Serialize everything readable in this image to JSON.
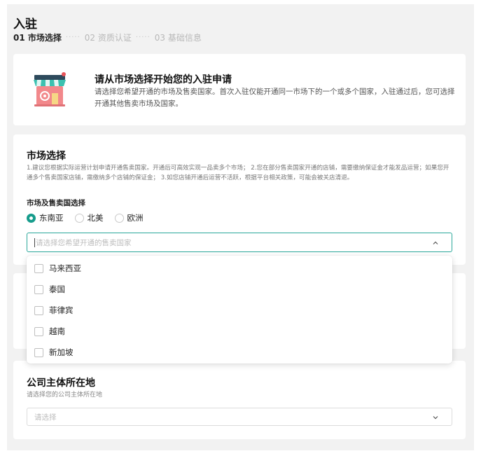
{
  "page": {
    "title": "入驻"
  },
  "steps": [
    {
      "label": "01 市场选择",
      "active": true
    },
    {
      "label": "02 资质认证",
      "active": false
    },
    {
      "label": "03 基础信息",
      "active": false
    }
  ],
  "step_separator": "·····",
  "intro": {
    "icon": "shop-icon",
    "title": "请从市场选择开始您的入驻申请",
    "description": "请选择您希望开通的市场及售卖国家。首次入驻仅能开通同一市场下的一个或多个国家，入驻通过后，您可选择开通其他售卖市场及国家。"
  },
  "market": {
    "title": "市场选择",
    "description": "1.建议您根据实际运营计划申请开通售卖国家。开通后可高效实现一品卖多个市场； 2.您在部分售卖国家开通的店铺，需要缴纳保证金才能发品运营；如果您开通多个售卖国家店铺，需缴纳多个店铺的保证金； 3.如您店铺开通后运营不活跃，根据平台相关政策，可能会被关店清退。",
    "field_label": "市场及售卖国选择",
    "regions": [
      {
        "label": "东南亚",
        "checked": true
      },
      {
        "label": "北美",
        "checked": false
      },
      {
        "label": "欧洲",
        "checked": false
      }
    ],
    "country_select": {
      "placeholder": "请选择您希望开通的售卖国家",
      "expanded": true
    }
  },
  "country_options": [
    {
      "label": "马来西亚",
      "checked": false
    },
    {
      "label": "泰国",
      "checked": false
    },
    {
      "label": "菲律宾",
      "checked": false
    },
    {
      "label": "越南",
      "checked": false
    },
    {
      "label": "新加坡",
      "checked": false
    }
  ],
  "company": {
    "title": "公司主体所在地",
    "subtitle": "请选择您的公司主体所在地",
    "select_placeholder": "请选择"
  },
  "colors": {
    "accent": "#169c8c",
    "page_background": "#f2f2f2",
    "card_background": "#ffffff"
  }
}
